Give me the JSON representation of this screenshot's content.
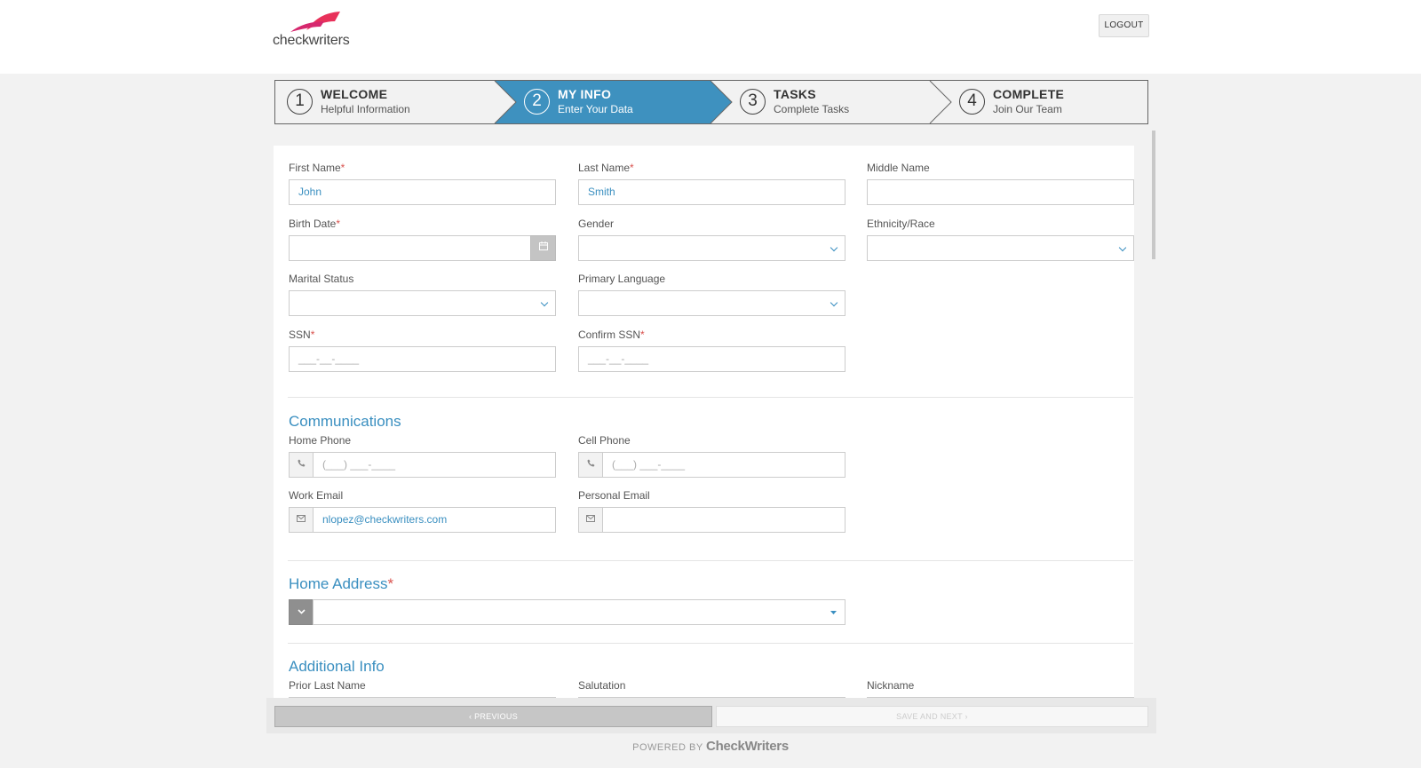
{
  "header": {
    "logo_text": "checkwriters",
    "logout_label": "LOGOUT"
  },
  "steps": [
    {
      "num": "1",
      "title": "WELCOME",
      "subtitle": "Helpful Information"
    },
    {
      "num": "2",
      "title": "MY INFO",
      "subtitle": "Enter Your Data"
    },
    {
      "num": "3",
      "title": "TASKS",
      "subtitle": "Complete Tasks"
    },
    {
      "num": "4",
      "title": "COMPLETE",
      "subtitle": "Join Our Team"
    }
  ],
  "active_step_color": "#3e91bf",
  "form": {
    "first_name": {
      "label": "First Name",
      "req": "*",
      "value": "John"
    },
    "last_name": {
      "label": "Last Name",
      "req": "*",
      "value": "Smith"
    },
    "middle_name": {
      "label": "Middle Name",
      "value": ""
    },
    "birth_date": {
      "label": "Birth Date",
      "req": "*",
      "value": ""
    },
    "gender": {
      "label": "Gender",
      "value": ""
    },
    "ethnicity": {
      "label": "Ethnicity/Race",
      "value": ""
    },
    "marital_status": {
      "label": "Marital Status",
      "value": ""
    },
    "primary_language": {
      "label": "Primary Language",
      "value": ""
    },
    "ssn": {
      "label": "SSN",
      "req": "*",
      "mask": "___-__-____"
    },
    "confirm_ssn": {
      "label": "Confirm SSN",
      "req": "*",
      "mask": "___-__-____"
    }
  },
  "communications": {
    "heading": "Communications",
    "home_phone": {
      "label": "Home Phone",
      "mask": "(___) ___-____"
    },
    "cell_phone": {
      "label": "Cell Phone",
      "mask": "(___) ___-____"
    },
    "work_email": {
      "label": "Work Email",
      "value": "nlopez@checkwriters.com"
    },
    "personal_email": {
      "label": "Personal Email",
      "value": ""
    }
  },
  "home_address": {
    "heading": "Home Address",
    "req": "*"
  },
  "additional_info": {
    "heading": "Additional Info",
    "prior_last_name": "Prior Last Name",
    "salutation": "Salutation",
    "nickname": "Nickname"
  },
  "footer": {
    "previous_label": "‹  PREVIOUS",
    "next_label": "SAVE AND NEXT  ›",
    "powered_by": "POWERED BY",
    "brand": "CheckWriters"
  }
}
